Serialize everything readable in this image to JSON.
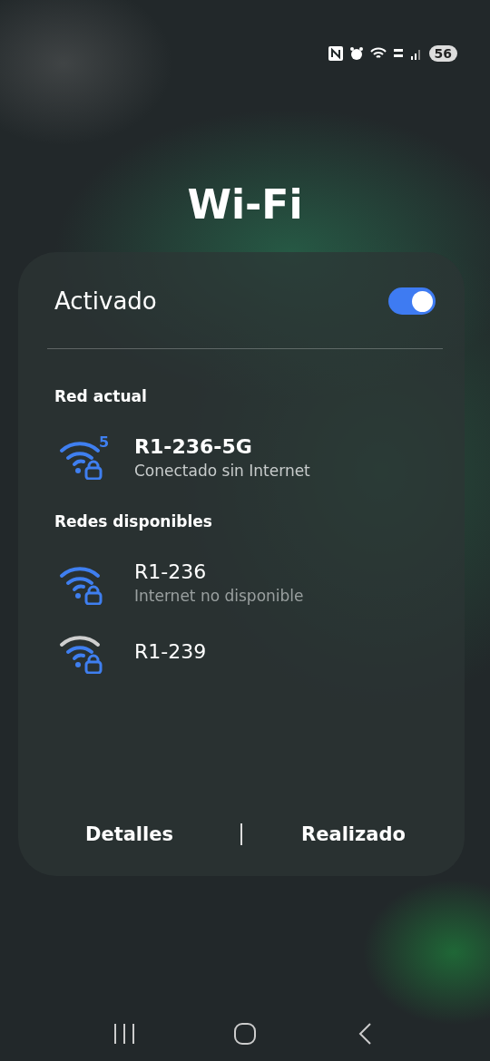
{
  "status_bar": {
    "battery": "56"
  },
  "title": "Wi-Fi",
  "panel": {
    "toggle_label": "Activado",
    "toggle_on": true,
    "current_header": "Red actual",
    "current": [
      {
        "name": "R1-236-5G",
        "status": "Conectado sin Internet",
        "band": "5",
        "weak_signal": false,
        "connected": true
      }
    ],
    "available_header": "Redes disponibles",
    "available": [
      {
        "name": "R1-236",
        "status": "Internet no disponible",
        "weak_signal": false,
        "connected": false
      },
      {
        "name": "R1-239",
        "weak_signal": true,
        "connected": false
      }
    ],
    "buttons": [
      "Detalles",
      "Realizado"
    ]
  }
}
